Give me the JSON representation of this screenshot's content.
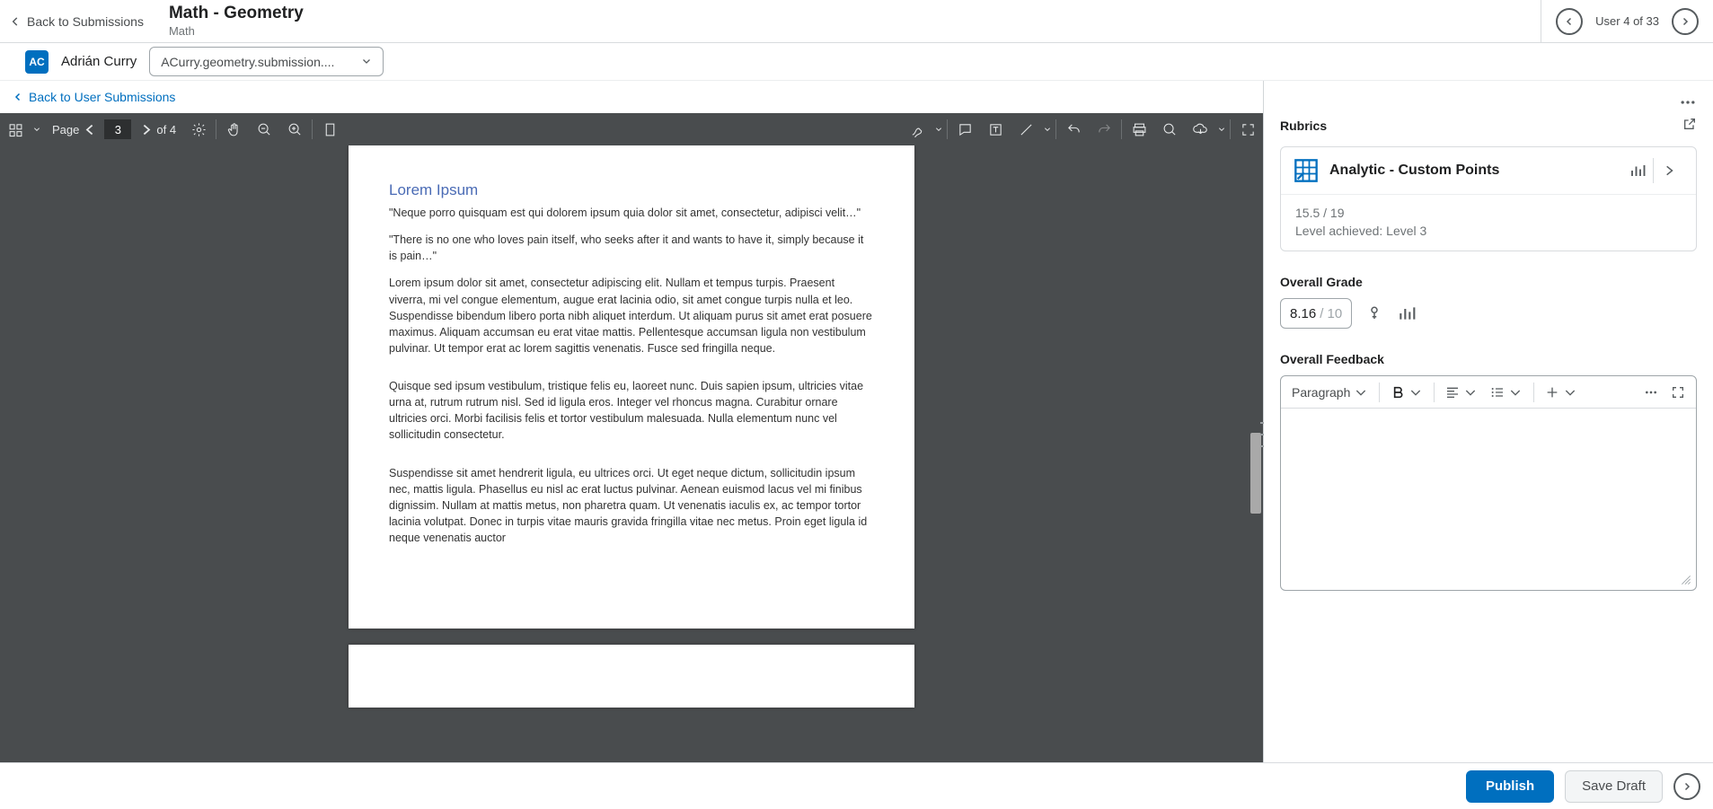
{
  "header": {
    "back_label": "Back to Submissions",
    "title": "Math - Geometry",
    "subtitle": "Math",
    "user_counter": "User 4 of 33"
  },
  "student": {
    "initials": "AC",
    "name": "Adrián Curry",
    "file": "ACurry.geometry.submission...."
  },
  "nav": {
    "back_user": "Back to User Submissions"
  },
  "pdf": {
    "page_label": "Page",
    "page_current": "3",
    "page_total": "of 4",
    "doc_title": "Lorem Ipsum",
    "p1": "\"Neque porro quisquam est qui dolorem ipsum quia dolor sit amet, consectetur, adipisci velit…\"",
    "p2": "\"There is no one who loves pain itself, who seeks after it and wants to have it, simply because it is pain…\"",
    "p3": "Lorem ipsum dolor sit amet, consectetur adipiscing elit. Nullam et tempus turpis. Praesent viverra, mi vel congue elementum, augue erat lacinia odio, sit amet congue turpis nulla et leo. Suspendisse bibendum libero porta nibh aliquet interdum. Ut aliquam purus sit amet erat posuere maximus. Aliquam accumsan eu erat vitae mattis. Pellentesque accumsan ligula non vestibulum pulvinar. Ut tempor erat ac lorem sagittis venenatis. Fusce sed fringilla neque.",
    "p4": "Quisque sed ipsum vestibulum, tristique felis eu, laoreet nunc. Duis sapien ipsum, ultricies vitae urna at, rutrum rutrum nisl. Sed id ligula eros. Integer vel rhoncus magna. Curabitur ornare ultricies orci. Morbi facilisis felis et tortor vestibulum malesuada. Nulla elementum nunc vel sollicitudin consectetur.",
    "p5": "Suspendisse sit amet hendrerit ligula, eu ultrices orci. Ut eget neque dictum, sollicitudin ipsum nec, mattis ligula. Phasellus eu nisl ac erat luctus pulvinar. Aenean euismod lacus vel mi finibus dignissim. Nullam at mattis metus, non pharetra quam. Ut venenatis iaculis ex, ac tempor tortor lacinia volutpat. Donec in turpis vitae mauris gravida fringilla vitae nec metus. Proin eget ligula id neque venenatis auctor"
  },
  "rubrics": {
    "heading": "Rubrics",
    "name": "Analytic - Custom Points",
    "score": "15.5 / 19",
    "level": "Level achieved: Level 3"
  },
  "grade": {
    "label": "Overall Grade",
    "value": "8.16",
    "max": "/ 10"
  },
  "feedback": {
    "label": "Overall Feedback",
    "format": "Paragraph"
  },
  "footer": {
    "publish": "Publish",
    "draft": "Save Draft"
  }
}
